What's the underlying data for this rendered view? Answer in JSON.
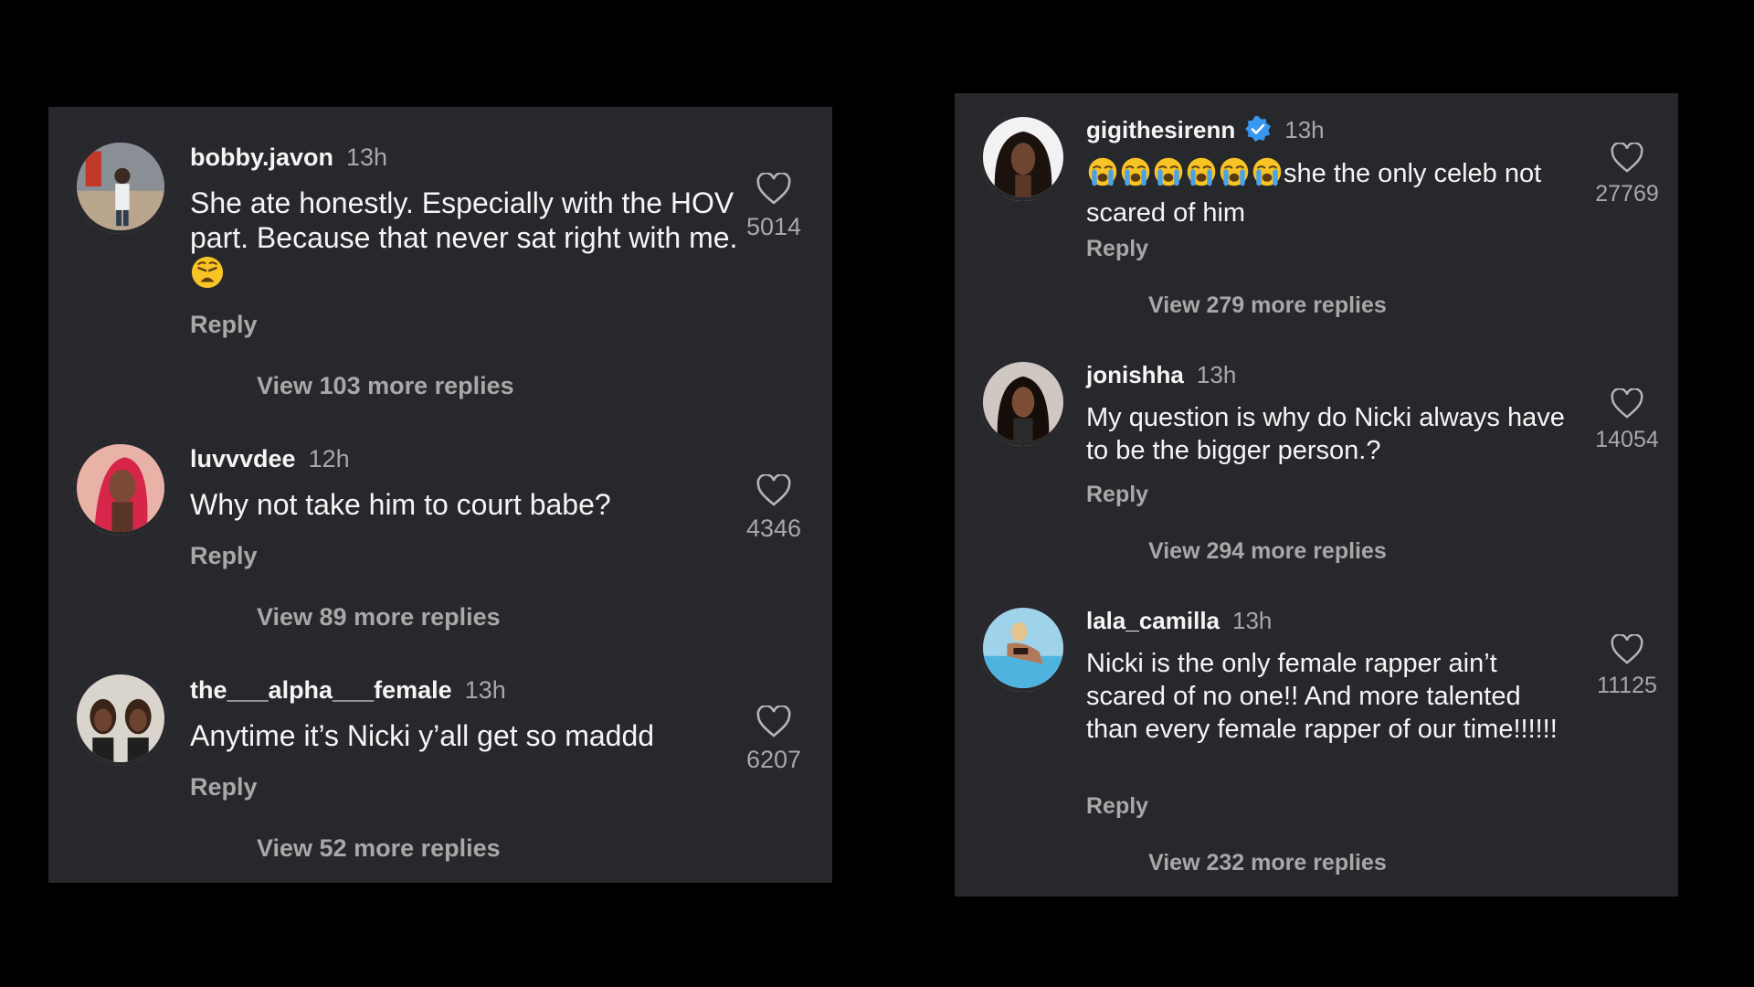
{
  "left_panel": {
    "comments": [
      {
        "username": "bobby.javon",
        "time": "13h",
        "text": "She ate honestly. Especially with the HOV part. Because that never sat right with me.",
        "emoji": "weary-face-emoji",
        "reply_label": "Reply",
        "likes": "5014",
        "view_replies": "View 103 more replies"
      },
      {
        "username": "luvvvdee",
        "time": "12h",
        "text": "Why not take him to court babe?",
        "reply_label": "Reply",
        "likes": "4346",
        "view_replies": "View 89 more replies"
      },
      {
        "username": "the___alpha___female",
        "time": "13h",
        "text": "Anytime it’s Nicki y’all get so maddd",
        "reply_label": "Reply",
        "likes": "6207",
        "view_replies": "View 52 more replies"
      }
    ]
  },
  "right_panel": {
    "comments": [
      {
        "username": "gigithesirenn",
        "verified": true,
        "time": "13h",
        "emoji": "loudly-crying-face-emoji",
        "emoji_count": 6,
        "text": "she the only celeb not scared of him",
        "reply_label": "Reply",
        "likes": "27769",
        "view_replies": "View 279 more replies"
      },
      {
        "username": "jonishha",
        "time": "13h",
        "text": "My question is why do Nicki always have to be the bigger person.?",
        "reply_label": "Reply",
        "likes": "14054",
        "view_replies": "View 294 more replies"
      },
      {
        "username": "lala_camilla",
        "time": "13h",
        "text": "Nicki is the only female rapper ain’t scared of no one!! And more talented than every female rapper of our time!!!!!!",
        "reply_label": "Reply",
        "likes": "11125",
        "view_replies": "View 232 more replies"
      }
    ]
  },
  "colors": {
    "background": "#000000",
    "panel": "#26282c",
    "primary_text": "#f5f5f5",
    "secondary_text": "#a8a8a8",
    "verified_badge": "#3897f0"
  },
  "icons": {
    "like": "heart-outline-icon",
    "verified": "verified-badge-icon"
  }
}
